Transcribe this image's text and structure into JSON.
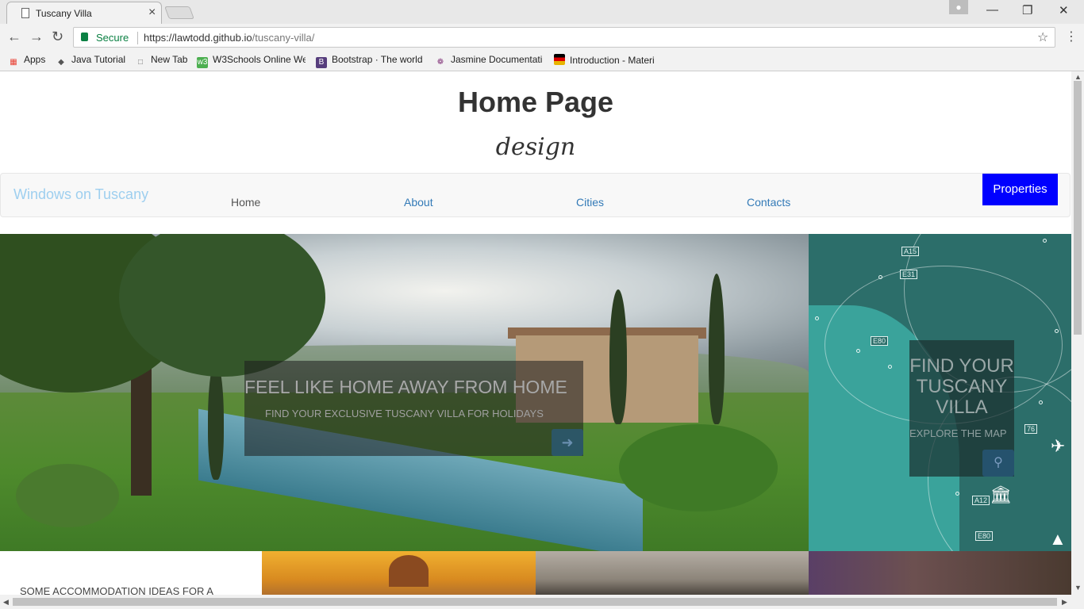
{
  "browser": {
    "tab_title": "Tuscany Villa",
    "secure_label": "Secure",
    "url_host": "https://lawtodd.github.io",
    "url_path": "/tuscany-villa/",
    "bookmarks": [
      {
        "label": "Apps",
        "icon": "apps-grid-icon",
        "color": "#e94235"
      },
      {
        "label": "Java Tutorial",
        "icon": "diamond-icon",
        "color": "#555555"
      },
      {
        "label": "New Tab",
        "icon": "page-icon",
        "color": "#777777"
      },
      {
        "label": "W3Schools Online We",
        "icon": "w3schools-icon",
        "color": "#4caf50"
      },
      {
        "label": "Bootstrap · The world",
        "icon": "bootstrap-icon",
        "color": "#563d7c"
      },
      {
        "label": "Jasmine Documentati",
        "icon": "jasmine-icon",
        "color": "#8a4182"
      },
      {
        "label": "Introduction - Materi",
        "icon": "flag-icon",
        "color": "#e8b400"
      }
    ]
  },
  "page": {
    "title": "Home Page",
    "subtitle": "design"
  },
  "navbar": {
    "brand": "Windows on Tuscany",
    "links": [
      "Home",
      "About",
      "Cities",
      "Contacts"
    ],
    "properties_label": "Properties"
  },
  "hero": {
    "heading": "FEEL LIKE HOME AWAY FROM HOME",
    "subheading": "FIND YOUR EXCLUSIVE TUSCANY VILLA FOR HOLIDAYS",
    "button_icon": "arrow-right-icon"
  },
  "map": {
    "heading": "FIND YOUR TUSCANY VILLA",
    "subheading": "EXPLORE THE MAP",
    "button_icon": "search-icon",
    "road_labels": [
      "A15",
      "E31",
      "E80",
      "A12",
      "E80",
      "76"
    ]
  },
  "strip": {
    "text": "SOME ACCOMMODATION IDEAS FOR A"
  }
}
